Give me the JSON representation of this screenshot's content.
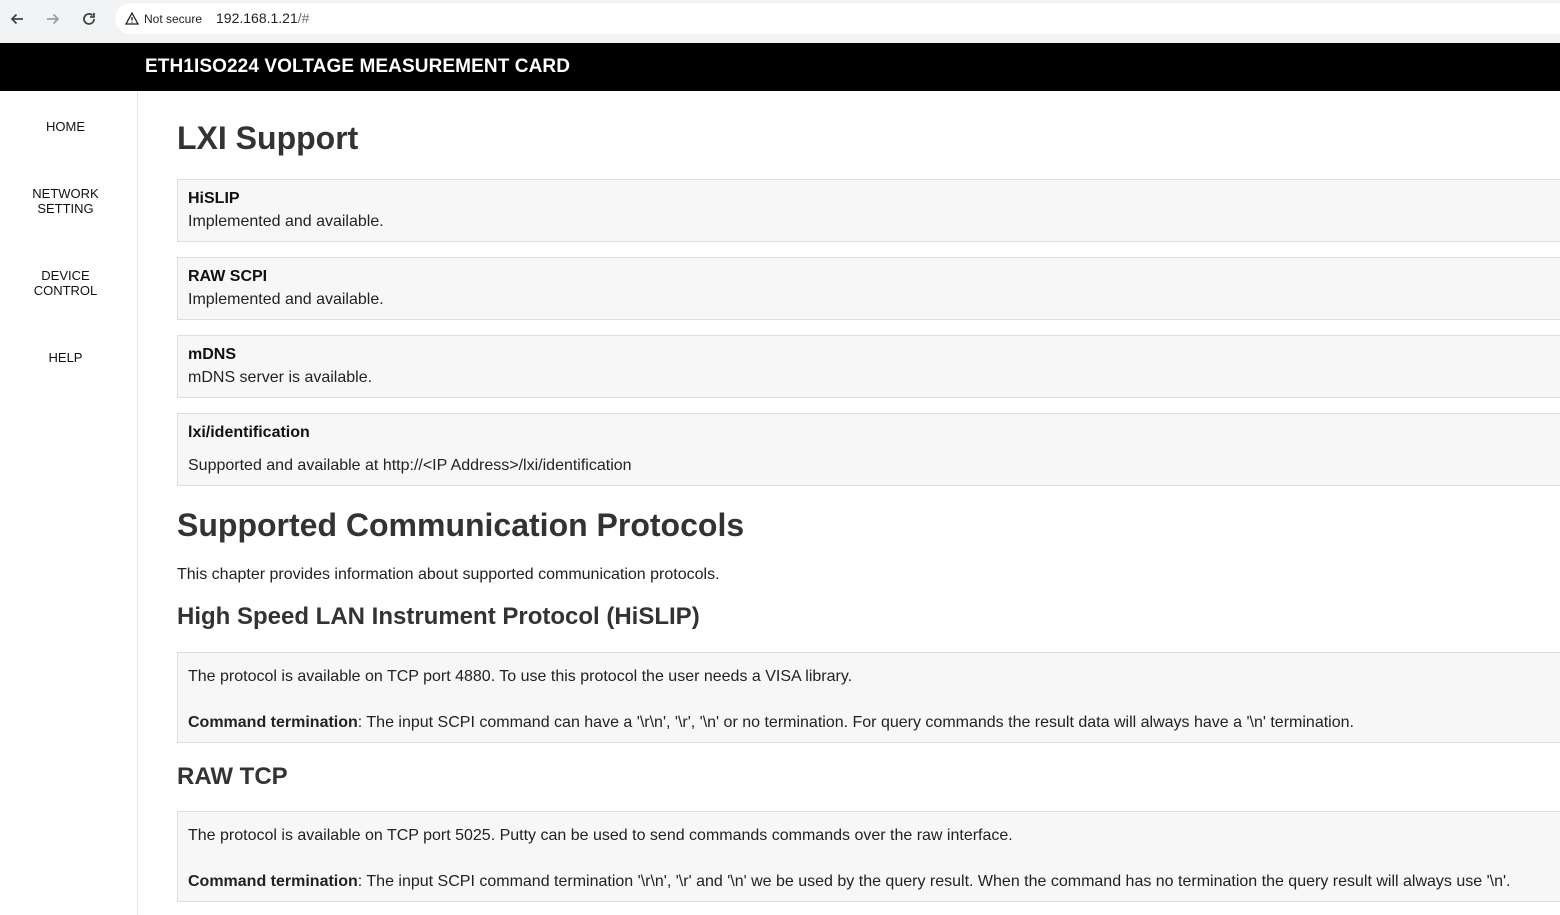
{
  "browser": {
    "back_icon": "arrow-left-icon",
    "forward_icon": "arrow-right-icon",
    "reload_icon": "reload-icon",
    "security_label": "Not secure",
    "url_host": "192.168.1.21",
    "url_path": "/#"
  },
  "header": {
    "title": "ETH1ISO224 VOLTAGE MEASUREMENT CARD"
  },
  "sidebar": {
    "items": [
      {
        "line1": "HOME",
        "line2": ""
      },
      {
        "line1": "NETWORK",
        "line2": "SETTING"
      },
      {
        "line1": "DEVICE",
        "line2": "CONTROL"
      },
      {
        "line1": "HELP",
        "line2": ""
      }
    ]
  },
  "lxi": {
    "heading": "LXI Support",
    "cards": [
      {
        "title": "HiSLIP",
        "desc": "Implemented and available."
      },
      {
        "title": "RAW SCPI",
        "desc": "Implemented and available."
      },
      {
        "title": "mDNS",
        "desc": "mDNS server is available."
      },
      {
        "title": "lxi/identification",
        "desc": "Supported and available at http://<IP Address>/lxi/identification"
      }
    ]
  },
  "protocols": {
    "heading": "Supported Communication Protocols",
    "intro": "This chapter provides information about supported communication protocols.",
    "hislip": {
      "heading": "High Speed LAN Instrument Protocol (HiSLIP)",
      "line1": "The protocol is available on TCP port 4880. To use this protocol the user needs a VISA library.",
      "term_label": "Command termination",
      "term_text": ": The input SCPI command can have a '\\r\\n', '\\r', '\\n' or no termination. For query commands the result data will always have a '\\n' termination."
    },
    "raw": {
      "heading": "RAW TCP",
      "line1": "The protocol is available on TCP port 5025. Putty can be used to send commands commands over the raw interface.",
      "term_label": "Command termination",
      "term_text": ": The input SCPI command termination '\\r\\n', '\\r' and '\\n' we be used by the query result. When the command has no termination the query result will always use '\\n'."
    }
  }
}
